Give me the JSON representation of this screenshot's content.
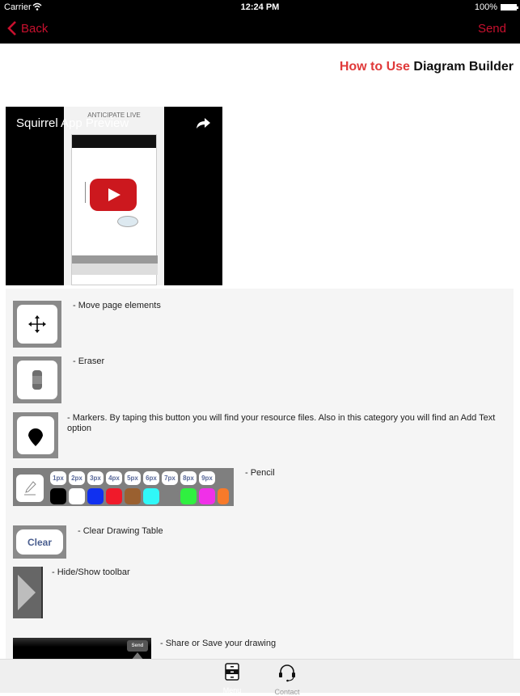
{
  "status_bar": {
    "carrier": "Carrier",
    "time": "12:24 PM",
    "battery": "100%"
  },
  "nav": {
    "back_label": "Back",
    "send_label": "Send",
    "accent_color": "#c8102e"
  },
  "page_title": {
    "highlight": "How to Use",
    "rest": "Diagram Builder"
  },
  "video": {
    "title": "Squirrel App Preview",
    "thumbnail_caption": "ANTICIPATE LIVE"
  },
  "instructions": [
    {
      "icon": "move-icon",
      "text": "- Move page elements"
    },
    {
      "icon": "eraser-icon",
      "text": "- Eraser"
    },
    {
      "icon": "marker-icon",
      "text": "- Markers. By taping this button you will find your resource files. Also in this category you will find an Add Text option"
    },
    {
      "icon": "pencil-icon",
      "text": "- Pencil"
    },
    {
      "icon": "clear-button",
      "text": "- Clear Drawing Table"
    },
    {
      "icon": "toolbar-toggle-icon",
      "text": "- Hide/Show toolbar"
    },
    {
      "icon": "send-bar-icon",
      "text": "- Share or Save your drawing"
    }
  ],
  "pencil_sizes": [
    "1px",
    "2px",
    "3px",
    "4px",
    "5px",
    "6px",
    "7px",
    "8px",
    "9px"
  ],
  "pencil_colors": [
    "#000000",
    "#ffffff",
    "#1030f0",
    "#f01a2a",
    "#9a6030",
    "#30f8f8",
    "#7f7f7f",
    "#30f040",
    "#f030e8",
    "#f87a2a"
  ],
  "clear_label": "Clear",
  "send_thumb_label": "Send",
  "tab_bar": {
    "tabs": [
      {
        "label": "Menu",
        "icon": "menu-cabinet-icon"
      },
      {
        "label": "Contact",
        "icon": "headset-icon"
      }
    ]
  }
}
